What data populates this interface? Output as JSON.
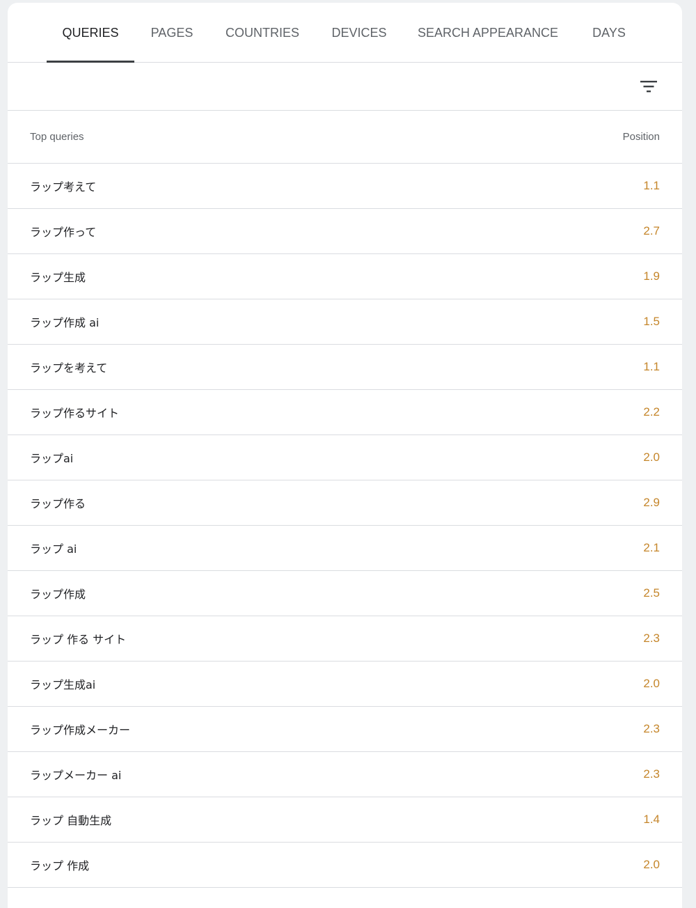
{
  "tabs": [
    {
      "label": "QUERIES",
      "active": true
    },
    {
      "label": "PAGES",
      "active": false
    },
    {
      "label": "COUNTRIES",
      "active": false
    },
    {
      "label": "DEVICES",
      "active": false
    },
    {
      "label": "SEARCH APPEARANCE",
      "active": false
    },
    {
      "label": "DAYS",
      "active": false
    }
  ],
  "toolbar": {
    "filter_icon": "filter-icon"
  },
  "table": {
    "header_query": "Top queries",
    "header_position": "Position",
    "position_color": "#c5862b",
    "rows": [
      {
        "query": "ラップ考えて",
        "position": "1.1"
      },
      {
        "query": "ラップ作って",
        "position": "2.7"
      },
      {
        "query": "ラップ生成",
        "position": "1.9"
      },
      {
        "query": "ラップ作成 ai",
        "position": "1.5"
      },
      {
        "query": "ラップを考えて",
        "position": "1.1"
      },
      {
        "query": "ラップ作るサイト",
        "position": "2.2"
      },
      {
        "query": "ラップai",
        "position": "2.0"
      },
      {
        "query": "ラップ作る",
        "position": "2.9"
      },
      {
        "query": "ラップ ai",
        "position": "2.1"
      },
      {
        "query": "ラップ作成",
        "position": "2.5"
      },
      {
        "query": "ラップ 作る サイト",
        "position": "2.3"
      },
      {
        "query": "ラップ生成ai",
        "position": "2.0"
      },
      {
        "query": "ラップ作成メーカー",
        "position": "2.3"
      },
      {
        "query": "ラップメーカー ai",
        "position": "2.3"
      },
      {
        "query": "ラップ 自動生成",
        "position": "1.4"
      },
      {
        "query": "ラップ 作成",
        "position": "2.0"
      }
    ]
  }
}
